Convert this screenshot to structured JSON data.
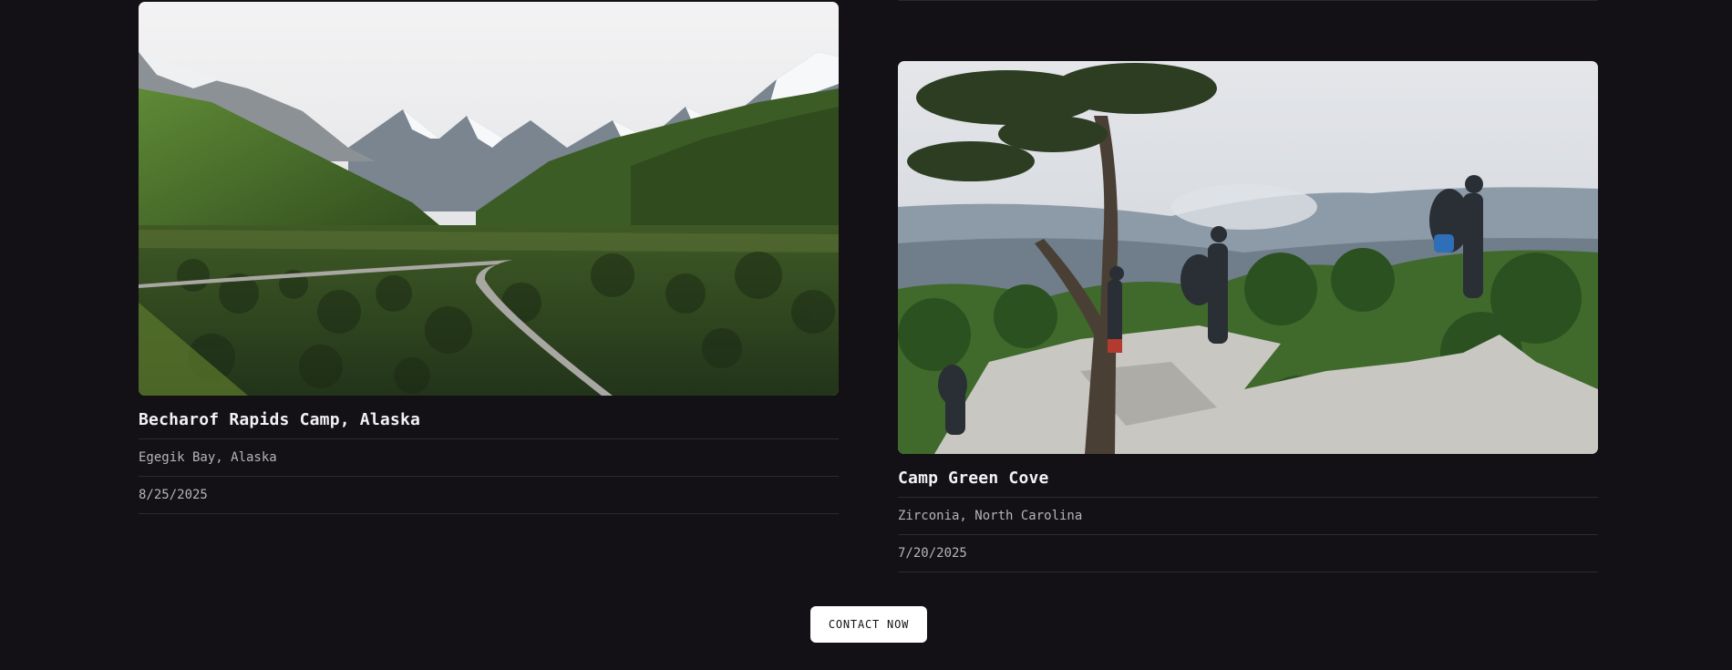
{
  "listings": [
    {
      "name": "Becharof Rapids Camp, Alaska",
      "location": "Egegik Bay, Alaska",
      "date": "8/25/2025"
    },
    {
      "name": "Camp Green Cove",
      "location": "Zirconia, North Carolina",
      "date": "7/20/2025"
    }
  ],
  "cta": {
    "label": "CONTACT NOW"
  },
  "colors": {
    "background": "#131115",
    "button": "#ffffff",
    "divider": "#2e2b31"
  }
}
